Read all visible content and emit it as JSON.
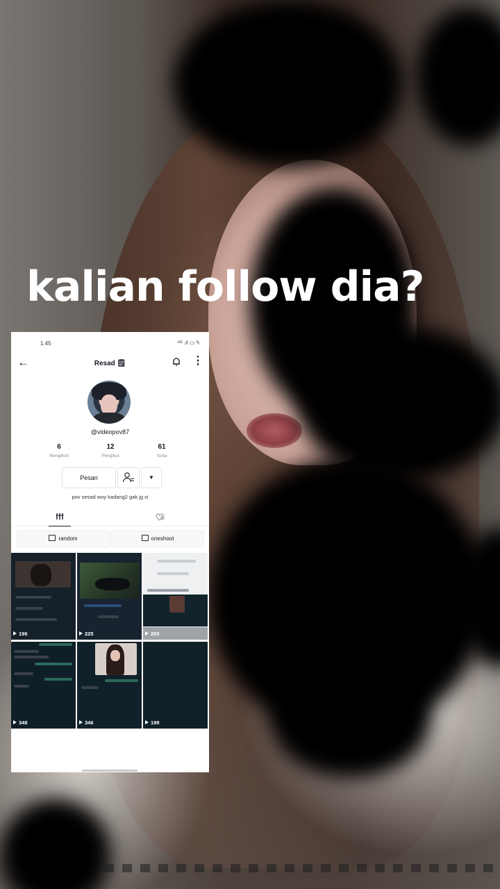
{
  "overlay": {
    "headline": "kalian follow dia?"
  },
  "phone": {
    "status_bar": {
      "time": "1.45",
      "icons": "⁴ᴳ .ıl ▭ ϟ"
    },
    "header": {
      "title": "Resad 🗒"
    },
    "profile": {
      "username": "@videopov87",
      "stats": [
        {
          "value": "6",
          "label": "Mengikuti"
        },
        {
          "value": "12",
          "label": "Pengikut"
        },
        {
          "value": "61",
          "label": "Suka"
        }
      ],
      "message_button": "Pesan",
      "bio": "pov sesad woy kadang2 gak jg si"
    },
    "playlists": [
      "random",
      "oneshoot"
    ],
    "videos": [
      {
        "views": "196"
      },
      {
        "views": "225"
      },
      {
        "views": "200"
      },
      {
        "views": "348"
      },
      {
        "views": "346"
      },
      {
        "views": "198"
      }
    ]
  }
}
